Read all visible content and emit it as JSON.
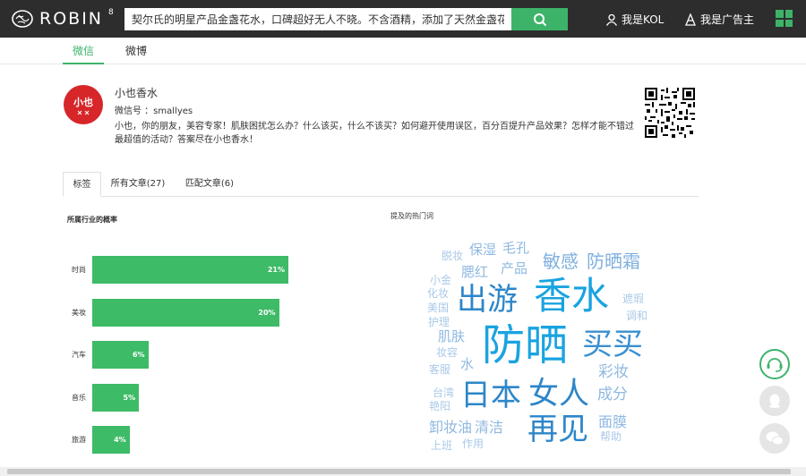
{
  "header": {
    "logo_text": "ROBIN",
    "logo_sup": "8",
    "search_value": "契尔氏的明星产品金盏花水，口碑超好无人不晓。不含酒精，添加了天然金盏花成分",
    "kol_label": "我是KOL",
    "advertiser_label": "我是广告主"
  },
  "nav": {
    "wechat": "微信",
    "weibo": "微博"
  },
  "profile": {
    "avatar_text": "小也",
    "name": "小也香水",
    "wechat_id": "微信号 ：smallyes",
    "description": "小也，你的朋友，美容专家！肌肤困扰怎么办？什么该买，什么不该买？如何避开使用误区，百分百提升产品效果？怎样才能不错过最超值的活动？答案尽在小也香水！"
  },
  "tabs": {
    "tags": "标签",
    "all_articles": "所有文章(27)",
    "matched_articles": "匹配文章(6)"
  },
  "industry": {
    "title": "所属行业的概率",
    "items": [
      {
        "label": "时尚",
        "value": 21,
        "value_text": "21%"
      },
      {
        "label": "美妆",
        "value": 20,
        "value_text": "20%"
      },
      {
        "label": "汽车",
        "value": 6,
        "value_text": "6%"
      },
      {
        "label": "音乐",
        "value": 5,
        "value_text": "5%"
      },
      {
        "label": "旅游",
        "value": 4,
        "value_text": "4%"
      }
    ]
  },
  "hot_words": {
    "title": "提及的热门词",
    "words": [
      "脱妆",
      "保湿",
      "毛孔",
      "敏感",
      "防晒霜",
      "腮红",
      "产品",
      "小金",
      "出游",
      "香水",
      "遮瑕",
      "化妆",
      "美国",
      "调和",
      "护理",
      "肌肤",
      "防晒",
      "买买",
      "妆容",
      "水",
      "彩妆",
      "客服",
      "台湾",
      "日本",
      "女人",
      "成分",
      "艳阳",
      "卸妆油",
      "清洁",
      "再见",
      "面膜",
      "上班",
      "作用",
      "帮助"
    ]
  },
  "colors": {
    "accent": "#3db36a",
    "avatar": "#d7262a",
    "topbar": "#2d2d2d"
  }
}
